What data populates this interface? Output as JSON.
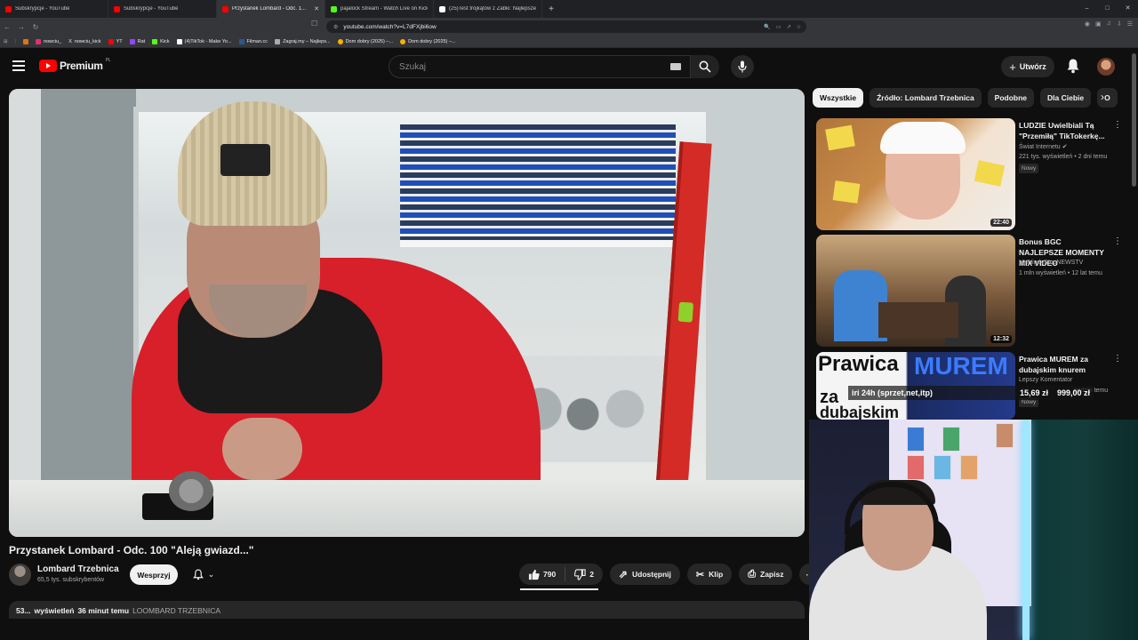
{
  "browser": {
    "tabs": [
      {
        "label": "Subskrypcje - YouTube",
        "color": "#ff0000",
        "active": false
      },
      {
        "label": "Subskrypcje - YouTube",
        "color": "#ff0000",
        "active": false
      },
      {
        "label": "Przystanek Lombard - Odc. 1...",
        "color": "#ff0000",
        "active": true
      },
      {
        "label": "pajalock Stream - Watch Live on Kick",
        "color": "#53fc18",
        "active": false
      },
      {
        "label": "(25)Test trójkątów z Żabki: Najlepsze...",
        "color": "#ffffff",
        "active": false
      }
    ],
    "new_tab": "+",
    "url": "youtube.com/watch?v=L7dFXjbi6ow",
    "window_controls": [
      "–",
      "□",
      "✕"
    ],
    "bookmarks": [
      {
        "label": "",
        "color": "#e8710a"
      },
      {
        "label": "nowciu_",
        "color": "#e1306c"
      },
      {
        "label": "nowciu_kick",
        "color": "#ffffff"
      },
      {
        "label": "YT",
        "color": "#ff0000"
      },
      {
        "label": "Rat",
        "color": "#9146ff"
      },
      {
        "label": "Kick",
        "color": "#53fc18"
      },
      {
        "label": "(4)TikTok - Make Yo...",
        "color": "#ffffff"
      },
      {
        "label": "Filman.cc",
        "color": "#2b5797"
      },
      {
        "label": "Zagraj.my – Najleps...",
        "color": "#aaaaaa"
      },
      {
        "label": "Dom dobry (2025) –...",
        "color": "#f4b400"
      },
      {
        "label": "Dom dobry (2025) –...",
        "color": "#f4b400"
      }
    ]
  },
  "youtube": {
    "logo_text": "Premium",
    "logo_country": "PL",
    "search_placeholder": "Szukaj",
    "create_label": "Utwórz"
  },
  "video": {
    "title": "Przystanek Lombard - Odc. 100 \"Aleją gwiazd...\"",
    "channel_name": "Lombard Trzebnica",
    "subscribers": "65,5 tys. subskrybentów",
    "join_label": "Wesprzyj",
    "likes": "790",
    "dislikes": "2",
    "share_label": "Udostępnij",
    "clip_label": "Klip",
    "save_label": "Zapisz",
    "views": "53...",
    "views_suffix": "wyświetleń",
    "posted": "36 minut temu",
    "tag": "LOOMBARD TRZEBNICA"
  },
  "sidebar": {
    "chips": [
      "Wszystkie",
      "Źródło: Lombard Trzebnica",
      "Podobne",
      "Dla Ciebie",
      "O"
    ],
    "recs": [
      {
        "title": "LUDZIE Uwielbiali Tą \"Przemiłą\" TikTokerkę...",
        "channel": "Świat Internetu ✔",
        "meta": "221 tys. wyświetleń • 2 dni temu",
        "badge": "Nowy",
        "duration": "22:40"
      },
      {
        "title": "Bonus BGC NAJLEPSZE MOMENTY MIX VIDEO",
        "channel": "HHNigdyStopNEWSTV",
        "meta": "1 mln wyświetleń • 12 lat temu",
        "badge": "",
        "duration": "12:32"
      },
      {
        "title": "Prawica MUREM za dubajskim knurem",
        "channel": "Lepszy Komentator",
        "meta": "godzin temu",
        "badge": "Nowy",
        "duration": ""
      }
    ],
    "overlay_label": "iri 24h (sprzet,net,itp)",
    "overlay_amount1": "15,69 zł",
    "overlay_amount2": "999,00 zł"
  }
}
